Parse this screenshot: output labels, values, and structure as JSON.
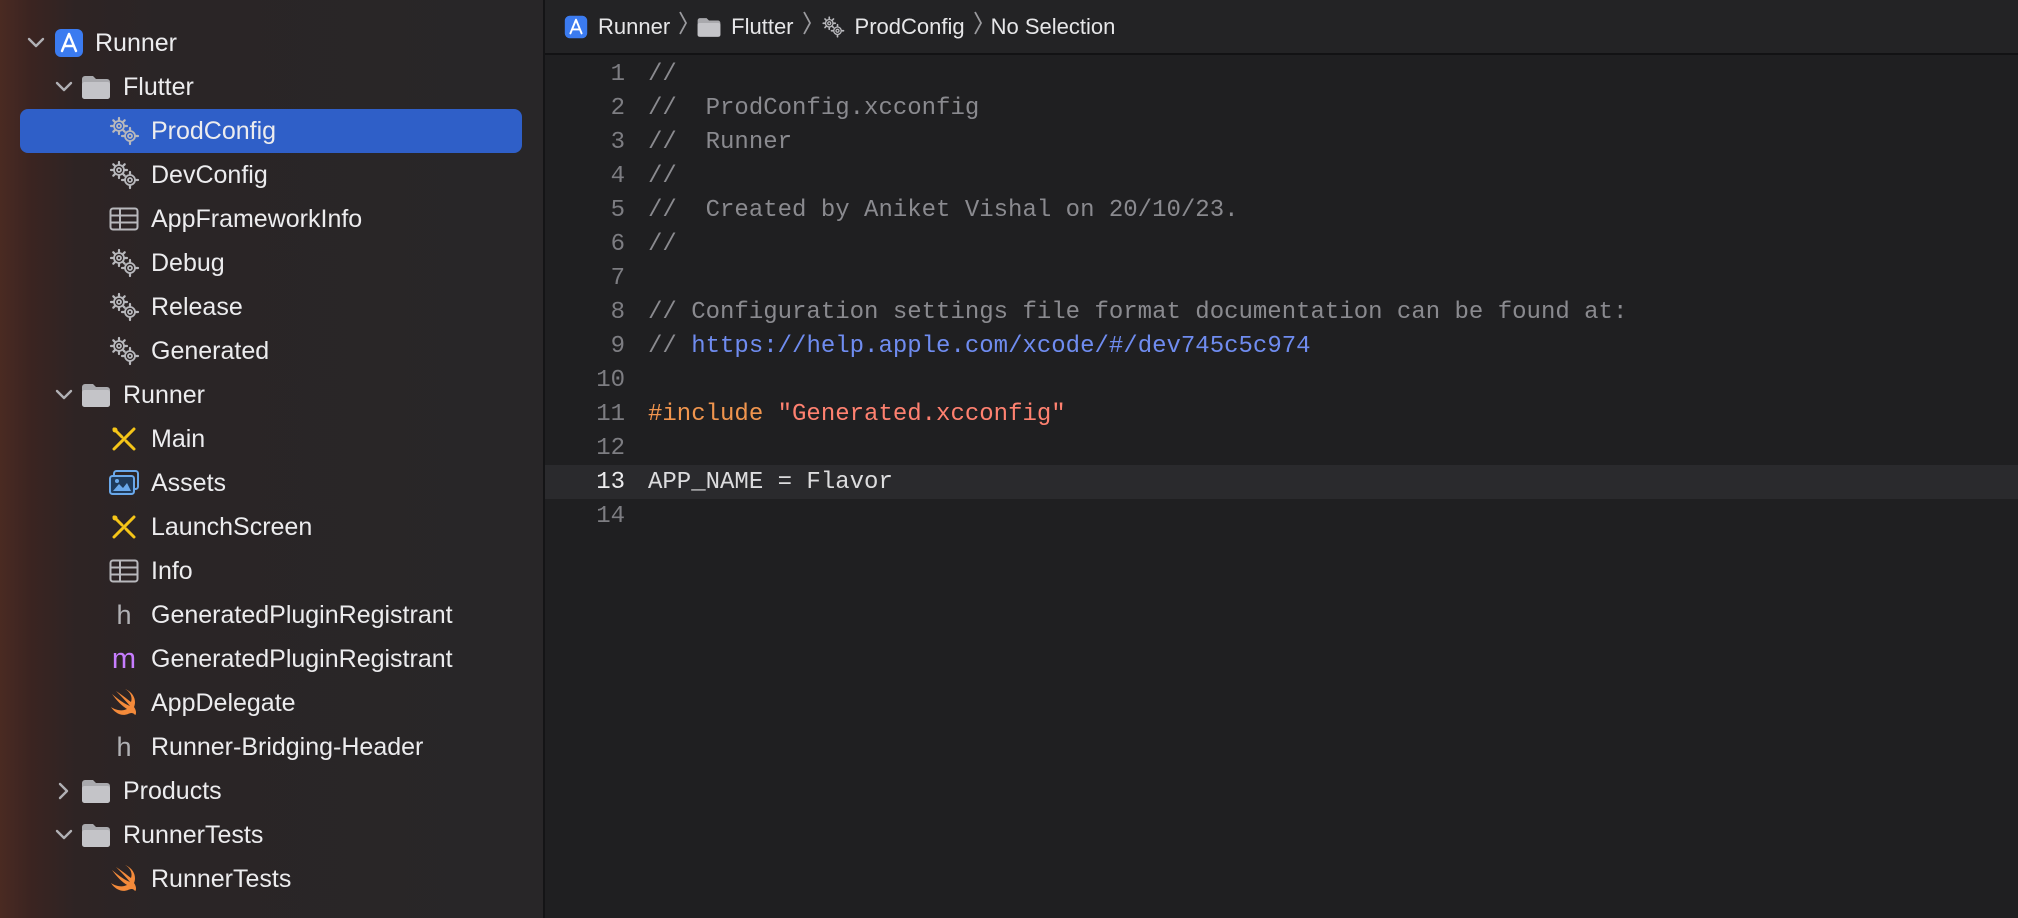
{
  "navigator": {
    "items": [
      {
        "label": "Runner",
        "kind": "project",
        "level": 0,
        "expanded": true
      },
      {
        "label": "Flutter",
        "kind": "folder",
        "level": 1,
        "expanded": true
      },
      {
        "label": "ProdConfig",
        "kind": "xcconfig",
        "level": 2,
        "selected": true
      },
      {
        "label": "DevConfig",
        "kind": "xcconfig",
        "level": 2
      },
      {
        "label": "AppFrameworkInfo",
        "kind": "plist",
        "level": 2
      },
      {
        "label": "Debug",
        "kind": "xcconfig",
        "level": 2
      },
      {
        "label": "Release",
        "kind": "xcconfig",
        "level": 2
      },
      {
        "label": "Generated",
        "kind": "xcconfig",
        "level": 2
      },
      {
        "label": "Runner",
        "kind": "folder",
        "level": 1,
        "expanded": true
      },
      {
        "label": "Main",
        "kind": "storyboard",
        "level": 2
      },
      {
        "label": "Assets",
        "kind": "assets",
        "level": 2
      },
      {
        "label": "LaunchScreen",
        "kind": "storyboard",
        "level": 2
      },
      {
        "label": "Info",
        "kind": "plist",
        "level": 2
      },
      {
        "label": "GeneratedPluginRegistrant",
        "kind": "header",
        "level": 2
      },
      {
        "label": "GeneratedPluginRegistrant",
        "kind": "objc",
        "level": 2
      },
      {
        "label": "AppDelegate",
        "kind": "swift",
        "level": 2
      },
      {
        "label": "Runner-Bridging-Header",
        "kind": "header",
        "level": 2
      },
      {
        "label": "Products",
        "kind": "folder",
        "level": 1,
        "expanded": false
      },
      {
        "label": "RunnerTests",
        "kind": "folder",
        "level": 1,
        "expanded": true
      },
      {
        "label": "RunnerTests",
        "kind": "swift",
        "level": 2
      }
    ]
  },
  "jumpbar": {
    "crumbs": [
      {
        "label": "Runner",
        "icon": "project-icon"
      },
      {
        "label": "Flutter",
        "icon": "folder-icon"
      },
      {
        "label": "ProdConfig",
        "icon": "gears-icon"
      },
      {
        "label": "No Selection",
        "icon": ""
      }
    ]
  },
  "editor": {
    "current_line": 13,
    "lines": [
      {
        "n": "1",
        "parts": [
          {
            "t": "//",
            "c": "cm"
          }
        ]
      },
      {
        "n": "2",
        "parts": [
          {
            "t": "//  ProdConfig.xcconfig",
            "c": "cm"
          }
        ]
      },
      {
        "n": "3",
        "parts": [
          {
            "t": "//  Runner",
            "c": "cm"
          }
        ]
      },
      {
        "n": "4",
        "parts": [
          {
            "t": "//",
            "c": "cm"
          }
        ]
      },
      {
        "n": "5",
        "parts": [
          {
            "t": "//  Created by Aniket Vishal on 20/10/23.",
            "c": "cm"
          }
        ]
      },
      {
        "n": "6",
        "parts": [
          {
            "t": "//",
            "c": "cm"
          }
        ]
      },
      {
        "n": "7",
        "parts": []
      },
      {
        "n": "8",
        "parts": [
          {
            "t": "// Configuration settings file format documentation can be found at:",
            "c": "cm"
          }
        ]
      },
      {
        "n": "9",
        "parts": [
          {
            "t": "// ",
            "c": "cm"
          },
          {
            "t": "https://help.apple.com/xcode/#/dev745c5c974",
            "c": "url"
          }
        ]
      },
      {
        "n": "10",
        "parts": []
      },
      {
        "n": "11",
        "parts": [
          {
            "t": "#include ",
            "c": "pp"
          },
          {
            "t": "\"Generated.xcconfig\"",
            "c": "str"
          }
        ]
      },
      {
        "n": "12",
        "parts": []
      },
      {
        "n": "13",
        "parts": [
          {
            "t": "APP_NAME = Flavor",
            "c": "plain"
          }
        ]
      },
      {
        "n": "14",
        "parts": []
      }
    ]
  },
  "colors": {
    "selection": "#2f5fc8",
    "comment": "#8a8a8f",
    "url": "#6f8cf0",
    "preprocessor": "#f0954e",
    "string": "#ff8170",
    "swift": "#f48a3a",
    "objc": "#c77dff",
    "storyboard": "#f5c518"
  }
}
